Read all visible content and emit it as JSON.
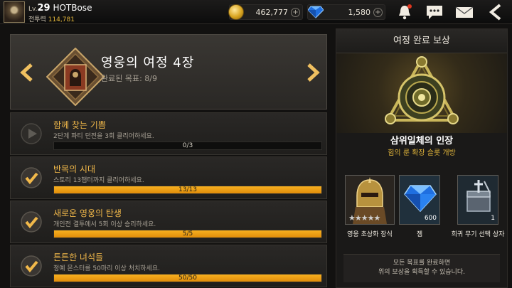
{
  "player": {
    "level_prefix": "Lv.",
    "level": "29",
    "name": "HOTBose",
    "power_label": "전투력",
    "power_value": "114,781"
  },
  "currency": {
    "gold": "462,777",
    "gems": "1,580",
    "plus": "+"
  },
  "icons": {
    "bell": "bell-icon",
    "chat": "chat-icon",
    "mail": "mail-icon",
    "back": "back-arrow-icon"
  },
  "colors": {
    "accent": "#f2b94a",
    "progress_fill": "#f7b020",
    "gold_text": "#e0b43a"
  },
  "chapter": {
    "title": "영웅의 여정 4장",
    "progress_text": "완료된 목표: 8/9"
  },
  "quests": [
    {
      "title": "함께 찾는 기쁨",
      "desc": "2단계 파티 던전을 3회 클리어하세요.",
      "progress": "0/3",
      "fraction": 0,
      "status": "play"
    },
    {
      "title": "반목의 시대",
      "desc": "스토리 13챕터까지 클리어하세요.",
      "progress": "13/13",
      "fraction": 1,
      "status": "done"
    },
    {
      "title": "새로운 영웅의 탄생",
      "desc": "개인전 결투에서 5회 이상 승리하세요.",
      "progress": "5/5",
      "fraction": 1,
      "status": "done"
    },
    {
      "title": "튼튼한 녀석들",
      "desc": "정예 몬스터를 50마리 이상 처치하세요.",
      "progress": "50/50",
      "fraction": 1,
      "status": "done"
    }
  ],
  "reward": {
    "header": "여정 완료 보상",
    "main_name": "삼위일체의 인장",
    "main_desc": "힘의 룬 확장 슬롯 개방",
    "items": [
      {
        "label": "영웅 초상화 장식",
        "qty": "",
        "icon": "hero-portrait-icon",
        "stars": 5
      },
      {
        "label": "젬",
        "qty": "600",
        "icon": "gem-icon"
      },
      {
        "label": "희귀 무기 선택 상자",
        "qty": "1",
        "icon": "weapon-box-icon"
      }
    ],
    "footer_line1": "모든 목표를 완료하면",
    "footer_line2": "위의 보상을 획득할 수 있습니다."
  }
}
